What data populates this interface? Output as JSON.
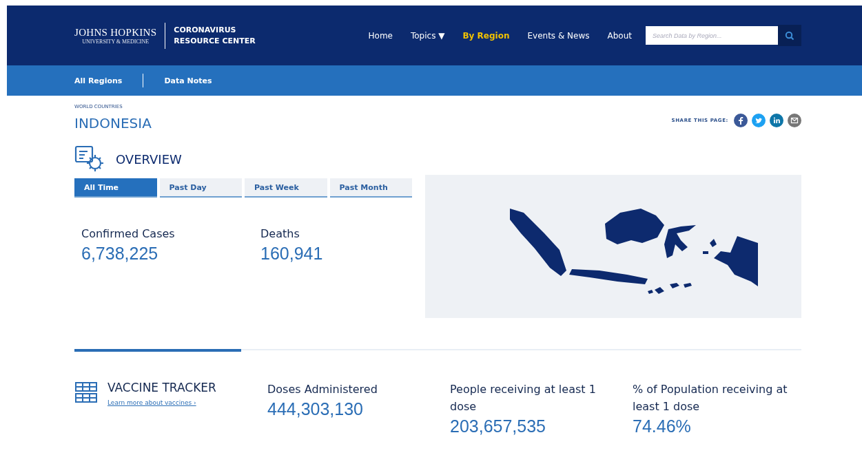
{
  "header": {
    "logo_top": "JOHNS HOPKINS",
    "logo_bottom": "UNIVERSITY & MEDICINE",
    "site_title": [
      "CORONAVIRUS",
      "RESOURCE CENTER"
    ],
    "nav": [
      {
        "label": "Home",
        "selected": false
      },
      {
        "label": "Topics ▼",
        "selected": false
      },
      {
        "label": "By Region",
        "selected": true
      },
      {
        "label": "Events & News",
        "selected": false
      },
      {
        "label": "About",
        "selected": false
      }
    ],
    "search": {
      "placeholder": "Search Data by Region..."
    }
  },
  "subnav": [
    "All Regions",
    "Data Notes"
  ],
  "breadcrumb": "WORLD COUNTRIES",
  "country": "INDONESIA",
  "share": {
    "label": "SHARE THIS PAGE:",
    "icons": [
      {
        "kind": "facebook",
        "color": "#3b5998"
      },
      {
        "kind": "twitter",
        "color": "#1da1f2"
      },
      {
        "kind": "linkedin",
        "color": "#0e76a8"
      },
      {
        "kind": "email",
        "color": "#777777"
      }
    ]
  },
  "overview": {
    "title": "OVERVIEW",
    "tabs": [
      {
        "label": "All Time",
        "selected": true
      },
      {
        "label": "Past Day",
        "selected": false
      },
      {
        "label": "Past Week",
        "selected": false
      },
      {
        "label": "Past Month",
        "selected": false
      }
    ],
    "stats": [
      {
        "label": "Confirmed Cases",
        "value": "6,738,225"
      },
      {
        "label": "Deaths",
        "value": "160,941"
      }
    ]
  },
  "vaccine": {
    "title": "VACCINE TRACKER",
    "link": "Learn more about vaccines ›",
    "stats": [
      {
        "label": "Doses Administered",
        "value": "444,303,130"
      },
      {
        "label": "People receiving at least 1 dose",
        "value": "203,657,535"
      },
      {
        "label": "% of Population receiving at least 1 dose",
        "value": "74.46%"
      }
    ]
  }
}
